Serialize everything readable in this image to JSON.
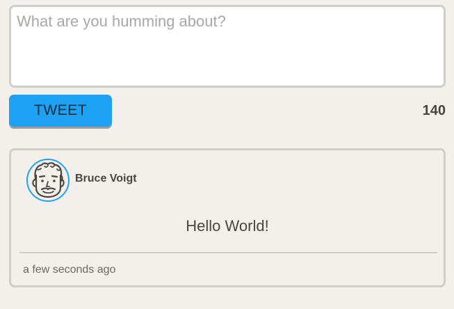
{
  "compose": {
    "placeholder": "What are you humming about?",
    "value": ""
  },
  "actions": {
    "tweet_label": "TWEET",
    "char_count": "140"
  },
  "tweet": {
    "author": "Bruce Voigt",
    "avatar_icon": "cartoon-face-avatar-icon",
    "text": "Hello World!",
    "timestamp": "a few seconds ago"
  },
  "colors": {
    "accent": "#1da1f2",
    "background": "#f3f0eb",
    "border": "#cfcdca",
    "text": "#4a4541"
  }
}
